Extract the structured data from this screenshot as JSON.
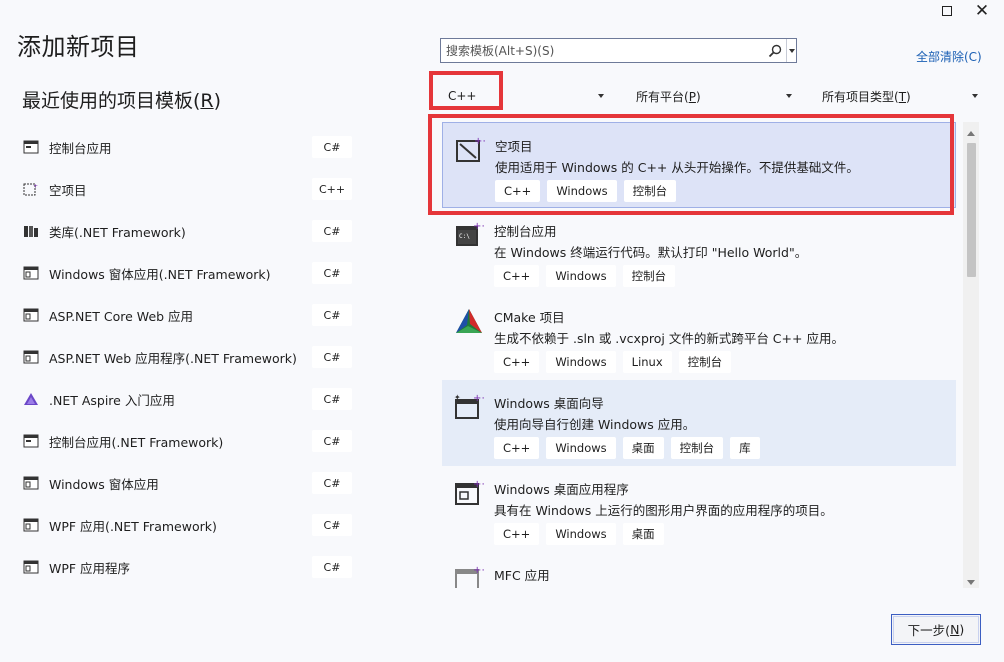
{
  "window": {
    "maximize_icon": "maximize-icon",
    "close_icon": "close-icon",
    "close_glyph": "✕"
  },
  "header": {
    "title": "添加新项目"
  },
  "recent": {
    "title_prefix": "最近使用的项目模板(",
    "title_key": "R",
    "title_suffix": ")",
    "items": [
      {
        "label": "控制台应用",
        "lang": "C#",
        "icon": "console-app-icon"
      },
      {
        "label": "空项目",
        "lang": "C++",
        "icon": "empty-project-icon"
      },
      {
        "label": "类库(.NET Framework)",
        "lang": "C#",
        "icon": "class-library-icon"
      },
      {
        "label": "Windows 窗体应用(.NET Framework)",
        "lang": "C#",
        "icon": "windows-forms-icon"
      },
      {
        "label": "ASP.NET Core Web 应用",
        "lang": "C#",
        "icon": "aspnet-core-icon"
      },
      {
        "label": "ASP.NET Web 应用程序(.NET Framework)",
        "lang": "C#",
        "icon": "aspnet-web-icon"
      },
      {
        "label": ".NET Aspire 入门应用",
        "lang": "C#",
        "icon": "aspire-icon"
      },
      {
        "label": "控制台应用(.NET Framework)",
        "lang": "C#",
        "icon": "console-app-framework-icon"
      },
      {
        "label": "Windows 窗体应用",
        "lang": "C#",
        "icon": "windows-forms-app-icon"
      },
      {
        "label": "WPF 应用(.NET Framework)",
        "lang": "C#",
        "icon": "wpf-framework-icon"
      },
      {
        "label": "WPF 应用程序",
        "lang": "C#",
        "icon": "wpf-app-icon"
      }
    ]
  },
  "search": {
    "placeholder": "搜索模板(Alt+S)(S)",
    "icon": "search-icon"
  },
  "clear_all": "全部清除(C)",
  "filters": {
    "language": "C++",
    "platform_prefix": "所有平台(",
    "platform_key": "P",
    "platform_suffix": ")",
    "type_prefix": "所有项目类型(",
    "type_key": "T",
    "type_suffix": ")"
  },
  "templates": [
    {
      "title": "空项目",
      "desc": "使用适用于 Windows 的 C++ 从头开始操作。不提供基础文件。",
      "tags": [
        "C++",
        "Windows",
        "控制台"
      ],
      "icon": "empty-project-icon"
    },
    {
      "title": "控制台应用",
      "desc": "在 Windows 终端运行代码。默认打印 \"Hello World\"。",
      "tags": [
        "C++",
        "Windows",
        "控制台"
      ],
      "icon": "console-app-icon"
    },
    {
      "title": "CMake 项目",
      "desc": "生成不依赖于 .sln 或 .vcxproj 文件的新式跨平台 C++ 应用。",
      "tags": [
        "C++",
        "Windows",
        "Linux",
        "控制台"
      ],
      "icon": "cmake-icon"
    },
    {
      "title": "Windows 桌面向导",
      "desc": "使用向导自行创建 Windows 应用。",
      "tags": [
        "C++",
        "Windows",
        "桌面",
        "控制台",
        "库"
      ],
      "icon": "desktop-wizard-icon"
    },
    {
      "title": "Windows 桌面应用程序",
      "desc": "具有在 Windows 上运行的图形用户界面的应用程序的项目。",
      "tags": [
        "C++",
        "Windows",
        "桌面"
      ],
      "icon": "desktop-app-icon"
    },
    {
      "title": "MFC 应用",
      "desc": "",
      "tags": [],
      "icon": "mfc-app-icon"
    }
  ],
  "footer": {
    "next_prefix": "下一步(",
    "next_key": "N",
    "next_suffix": ")"
  },
  "colors": {
    "highlight_red": "#e5363a",
    "selected_bg": "#dde3f7",
    "link_blue": "#1a5fb4"
  }
}
